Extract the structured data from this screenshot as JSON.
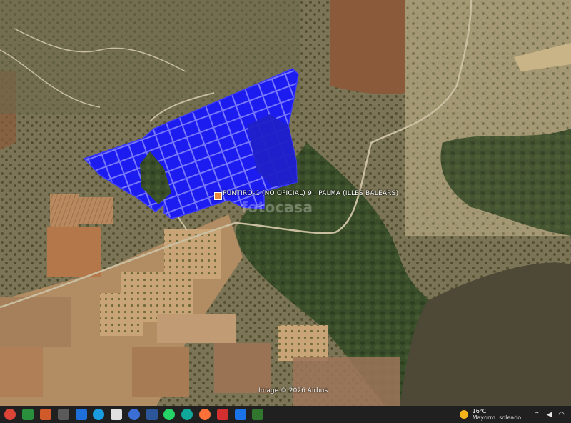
{
  "map": {
    "type": "satellite",
    "place_label": "PUNTIRO-C (NO OFICIAL) 9 , PALMA (ILLES BALEARS)",
    "watermark": "fotocasa",
    "attribution": "Image © 2026 Airbus",
    "parcel_overlay_color": "#1a1aff",
    "marker_color": "#e8893a"
  },
  "taskbar": {
    "apps": [
      {
        "name": "chrome-icon",
        "color": "#db4437"
      },
      {
        "name": "document-app-icon",
        "color": "#2a8f3c"
      },
      {
        "name": "presentation-icon",
        "color": "#d05a2a"
      },
      {
        "name": "task-view-icon",
        "color": "#5a5a5a"
      },
      {
        "name": "photos-icon",
        "color": "#1e6fd9"
      },
      {
        "name": "edge-icon",
        "color": "#1a9be0"
      },
      {
        "name": "file-icon",
        "color": "#e0e0e0"
      },
      {
        "name": "globe-icon",
        "color": "#3b6fd6"
      },
      {
        "name": "store-icon",
        "color": "#2b579a"
      },
      {
        "name": "whatsapp-icon",
        "color": "#25d366"
      },
      {
        "name": "teal-app-icon",
        "color": "#0fa89a"
      },
      {
        "name": "firefox-icon",
        "color": "#ff7139"
      },
      {
        "name": "acrobat-icon",
        "color": "#d32f2f"
      },
      {
        "name": "sway-icon",
        "color": "#1a73e8"
      },
      {
        "name": "project-icon",
        "color": "#31752f"
      }
    ],
    "weather": {
      "temp": "16°C",
      "desc": "Mayorm. soleado"
    }
  }
}
